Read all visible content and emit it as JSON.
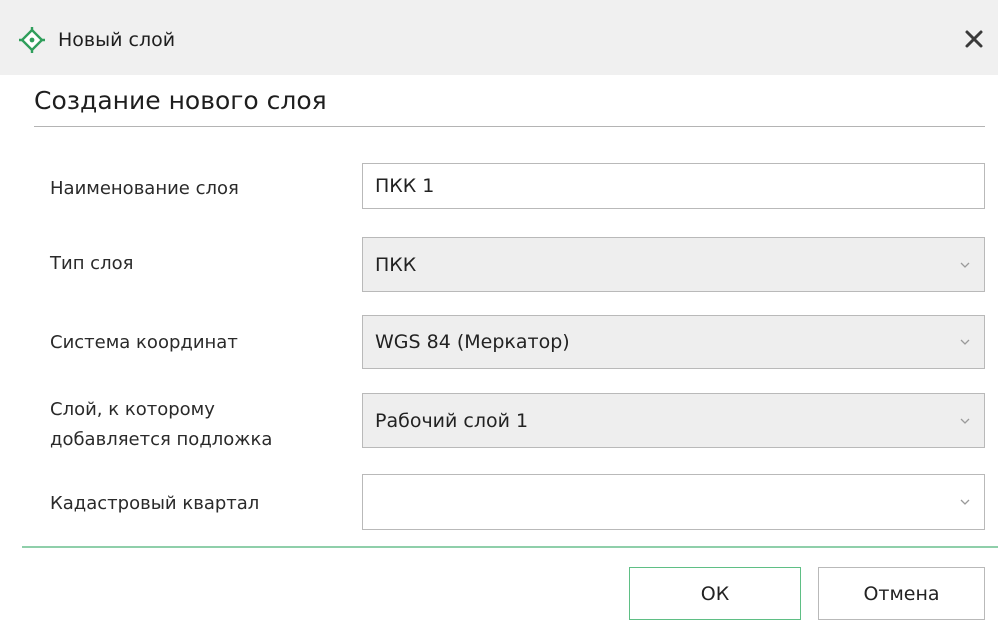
{
  "window": {
    "title": "Новый слой",
    "icon": "layer-target-icon",
    "accent_color": "#2f9e5b"
  },
  "heading": "Создание нового слоя",
  "fields": {
    "name": {
      "label": "Наименование слоя",
      "value": "ПКК 1"
    },
    "type": {
      "label": "Тип слоя",
      "value": "ПКК"
    },
    "crs": {
      "label": "Система координат",
      "value": "WGS 84 (Меркатор)"
    },
    "target_layer": {
      "label_line1": "Слой, к которому",
      "label_line2": "добавляется подложка",
      "value": "Рабочий слой 1"
    },
    "cadastral": {
      "label": "Кадастровый квартал",
      "value": ""
    }
  },
  "buttons": {
    "ok": "ОК",
    "cancel": "Отмена"
  }
}
